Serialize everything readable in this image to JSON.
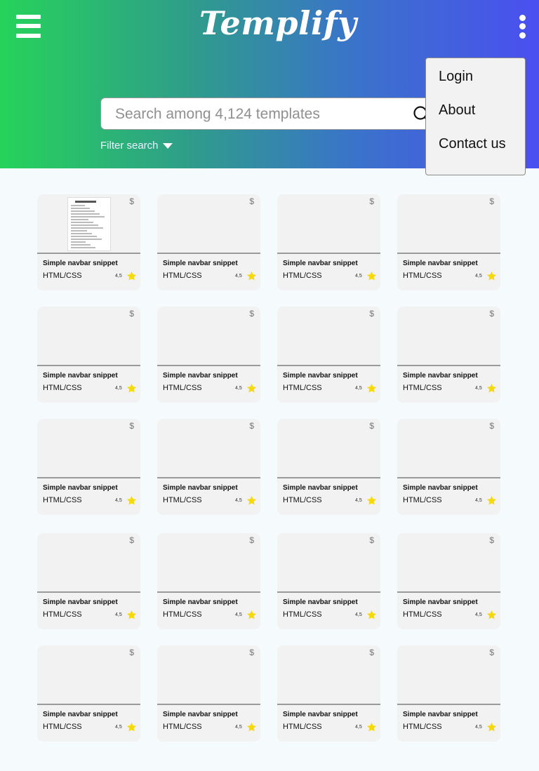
{
  "header": {
    "logo_text": "Templify",
    "gradient": [
      "#26d35a",
      "#4a4ff0"
    ]
  },
  "search": {
    "placeholder": "Search among 4,124 templates",
    "value": ""
  },
  "filter": {
    "label": "Filter search"
  },
  "menu": {
    "items": [
      {
        "label": "Login"
      },
      {
        "label": "About"
      },
      {
        "label": "Contact us"
      }
    ]
  },
  "cards": [
    {
      "title": "Simple navbar snippet",
      "tech": "HTML/CSS",
      "rating": "4,5",
      "price": "$",
      "has_preview": true
    },
    {
      "title": "Simple navbar snippet",
      "tech": "HTML/CSS",
      "rating": "4,5",
      "price": "$",
      "has_preview": false
    },
    {
      "title": "Simple navbar snippet",
      "tech": "HTML/CSS",
      "rating": "4,5",
      "price": "$",
      "has_preview": false
    },
    {
      "title": "Simple navbar snippet",
      "tech": "HTML/CSS",
      "rating": "4,5",
      "price": "$",
      "has_preview": false
    },
    {
      "title": "Simple navbar snippet",
      "tech": "HTML/CSS",
      "rating": "4,5",
      "price": "$",
      "has_preview": false
    },
    {
      "title": "Simple navbar snippet",
      "tech": "HTML/CSS",
      "rating": "4,5",
      "price": "$",
      "has_preview": false
    },
    {
      "title": "Simple navbar snippet",
      "tech": "HTML/CSS",
      "rating": "4,5",
      "price": "$",
      "has_preview": false
    },
    {
      "title": "Simple navbar snippet",
      "tech": "HTML/CSS",
      "rating": "4,5",
      "price": "$",
      "has_preview": false
    },
    {
      "title": "Simple navbar snippet",
      "tech": "HTML/CSS",
      "rating": "4,5",
      "price": "$",
      "has_preview": false
    },
    {
      "title": "Simple navbar snippet",
      "tech": "HTML/CSS",
      "rating": "4,5",
      "price": "$",
      "has_preview": false
    },
    {
      "title": "Simple navbar snippet",
      "tech": "HTML/CSS",
      "rating": "4,5",
      "price": "$",
      "has_preview": false
    },
    {
      "title": "Simple navbar snippet",
      "tech": "HTML/CSS",
      "rating": "4,5",
      "price": "$",
      "has_preview": false
    },
    {
      "title": "Simple navbar snippet",
      "tech": "HTML/CSS",
      "rating": "4,5",
      "price": "$",
      "has_preview": false
    },
    {
      "title": "Simple navbar snippet",
      "tech": "HTML/CSS",
      "rating": "4,5",
      "price": "$",
      "has_preview": false
    },
    {
      "title": "Simple navbar snippet",
      "tech": "HTML/CSS",
      "rating": "4,5",
      "price": "$",
      "has_preview": false
    },
    {
      "title": "Simple navbar snippet",
      "tech": "HTML/CSS",
      "rating": "4,5",
      "price": "$",
      "has_preview": false
    },
    {
      "title": "Simple navbar snippet",
      "tech": "HTML/CSS",
      "rating": "4,5",
      "price": "$",
      "has_preview": false
    },
    {
      "title": "Simple navbar snippet",
      "tech": "HTML/CSS",
      "rating": "4,5",
      "price": "$",
      "has_preview": false
    },
    {
      "title": "Simple navbar snippet",
      "tech": "HTML/CSS",
      "rating": "4,5",
      "price": "$",
      "has_preview": false
    },
    {
      "title": "Simple navbar snippet",
      "tech": "HTML/CSS",
      "rating": "4,5",
      "price": "$",
      "has_preview": false
    }
  ],
  "colors": {
    "page_bg": "#f5fbfd",
    "card_bg": "#f2f2f2",
    "star": "#f5d90a",
    "menu_bg": "#f2f2f2"
  }
}
